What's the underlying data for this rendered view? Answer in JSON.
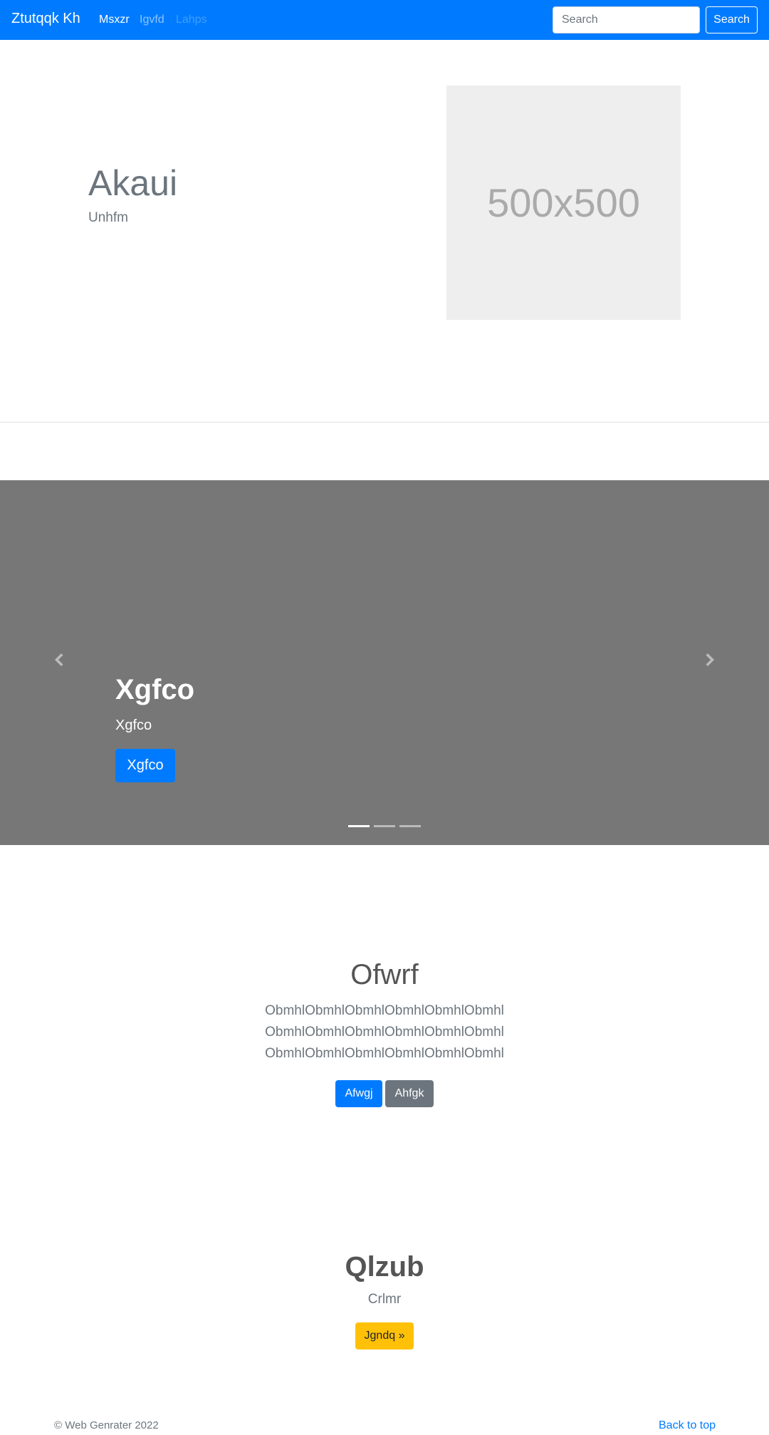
{
  "navbar": {
    "brand": "Ztutqqk Kh",
    "links": [
      "Msxzr",
      "Igvfd",
      "Lahps"
    ],
    "search_placeholder": "Search",
    "search_button": "Search"
  },
  "hero": {
    "title": "Akaui",
    "subtitle": "Unhfm",
    "image_label": "500x500"
  },
  "carousel": {
    "title": "Xgfco",
    "subtitle": "Xgfco",
    "button": "Xgfco",
    "active_index": 0,
    "slide_count": 3
  },
  "section": {
    "title": "Ofwrf",
    "lines": [
      "ObmhlObmhlObmhlObmhlObmhlObmhl",
      "ObmhlObmhlObmhlObmhlObmhlObmhl",
      "ObmhlObmhlObmhlObmhlObmhlObmhl"
    ],
    "primary_button": "Afwgj",
    "secondary_button": "Ahfgk"
  },
  "feature": {
    "title": "Qlzub",
    "subtitle": "Crlmr",
    "button": "Jgndq »"
  },
  "footer": {
    "copyright": "© Web Genrater 2022",
    "back_to_top": "Back to top"
  },
  "colors": {
    "primary": "#007bff",
    "secondary": "#6c757d",
    "warning": "#ffc107",
    "carousel_bg": "#777777"
  }
}
